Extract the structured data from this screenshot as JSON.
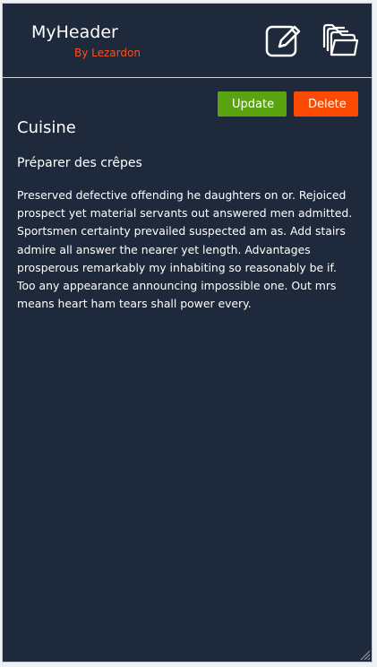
{
  "header": {
    "title": "MyHeader",
    "subtitle": "By Lezardon",
    "edit_icon": "edit-icon",
    "folder_icon": "folders-icon"
  },
  "actions": {
    "update_label": "Update",
    "delete_label": "Delete"
  },
  "content": {
    "section_title": "Cuisine",
    "recipe_title": "Préparer des crêpes",
    "recipe_body": "Preserved defective offending he daughters on or. Rejoiced prospect yet material servants out answered men admitted. Sportsmen certainty prevailed suspected am as. Add stairs admire all answer the nearer yet length. Advantages prosperous remarkably my inhabiting so reasonably be if. Too any appearance announcing impossible one. Out mrs means heart ham tears shall power every."
  },
  "colors": {
    "background": "#1e293b",
    "accent_subtitle": "#ff4f1f",
    "update_button": "#5aa311",
    "delete_button": "#fb4b02"
  }
}
